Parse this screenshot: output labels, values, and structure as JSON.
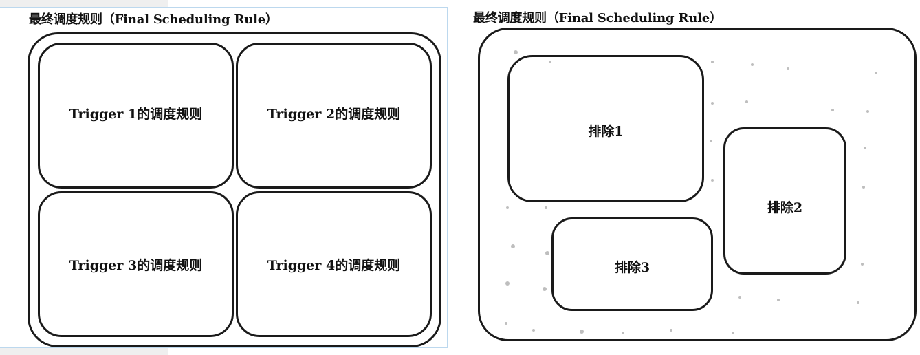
{
  "left_diagram": {
    "title": "最终调度规则（Final Scheduling Rule）",
    "cells": [
      {
        "label": "Trigger 1的调度规则"
      },
      {
        "label": "Trigger 2的调度规则"
      },
      {
        "label": "Trigger 3的调度规则"
      },
      {
        "label": "Trigger 4的调度规则"
      }
    ]
  },
  "right_diagram": {
    "title": "最终调度规则（Final Scheduling Rule）",
    "exclusions": [
      {
        "label": "排除1"
      },
      {
        "label": "排除2"
      },
      {
        "label": "排除3"
      }
    ]
  }
}
